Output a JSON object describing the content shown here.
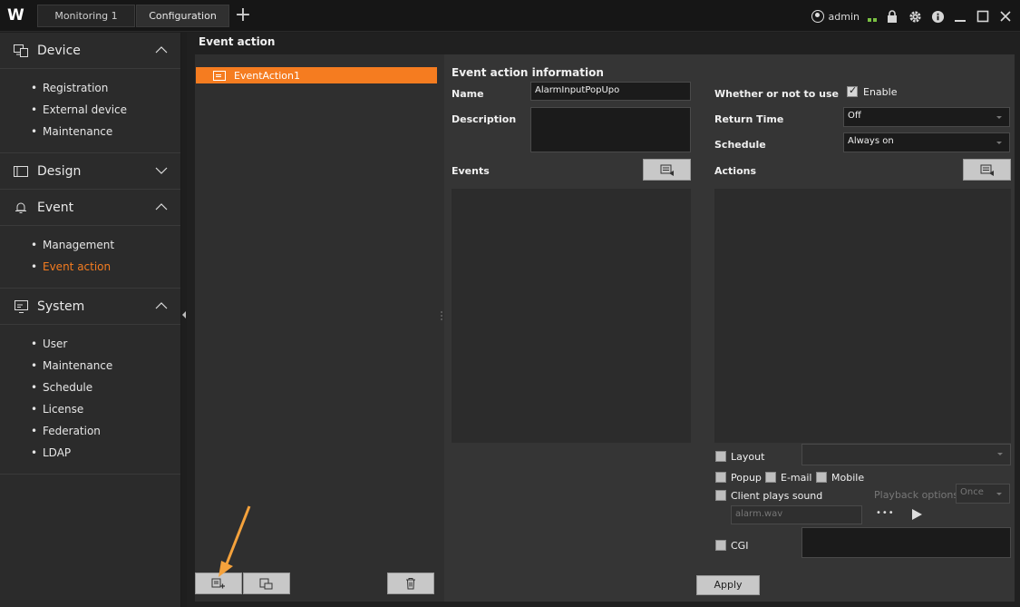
{
  "topbar": {
    "logo": "W",
    "tabs": [
      {
        "label": "Monitoring 1"
      },
      {
        "label": "Configuration"
      }
    ],
    "add_tab_icon": "plus-icon",
    "user": "admin"
  },
  "sidebar": {
    "sections": [
      {
        "title": "Device",
        "icon": "device-icon",
        "expanded": true,
        "items": [
          "Registration",
          "External device",
          "Maintenance"
        ]
      },
      {
        "title": "Design",
        "icon": "design-icon",
        "expanded": false,
        "items": []
      },
      {
        "title": "Event",
        "icon": "bell-icon",
        "expanded": true,
        "items": [
          "Management",
          "Event action"
        ],
        "active_item": "Event action"
      },
      {
        "title": "System",
        "icon": "system-icon",
        "expanded": true,
        "items": [
          "User",
          "Maintenance",
          "Schedule",
          "License",
          "Federation",
          "LDAP"
        ]
      }
    ]
  },
  "main": {
    "title": "Event action",
    "list": {
      "items": [
        "EventAction1"
      ],
      "selected": "EventAction1"
    },
    "info": {
      "title": "Event action information",
      "name_label": "Name",
      "name_value": "AlarmInputPopUpo",
      "description_label": "Description",
      "description_value": "",
      "events_label": "Events",
      "use_label": "Whether or not to use",
      "enable_label": "Enable",
      "enable_checked": true,
      "return_time_label": "Return Time",
      "return_time_value": "Off",
      "schedule_label": "Schedule",
      "schedule_value": "Always on",
      "actions_label": "Actions",
      "layout_label": "Layout",
      "popup_label": "Popup",
      "email_label": "E-mail",
      "mobile_label": "Mobile",
      "client_sound_label": "Client plays sound",
      "playback_label": "Playback options",
      "playback_value": "Once",
      "sound_file": "alarm.wav",
      "more_label": "•••",
      "cgi_label": "CGI",
      "apply_label": "Apply"
    }
  },
  "colors": {
    "accent": "#f57c20",
    "signal": "#7ac143"
  }
}
